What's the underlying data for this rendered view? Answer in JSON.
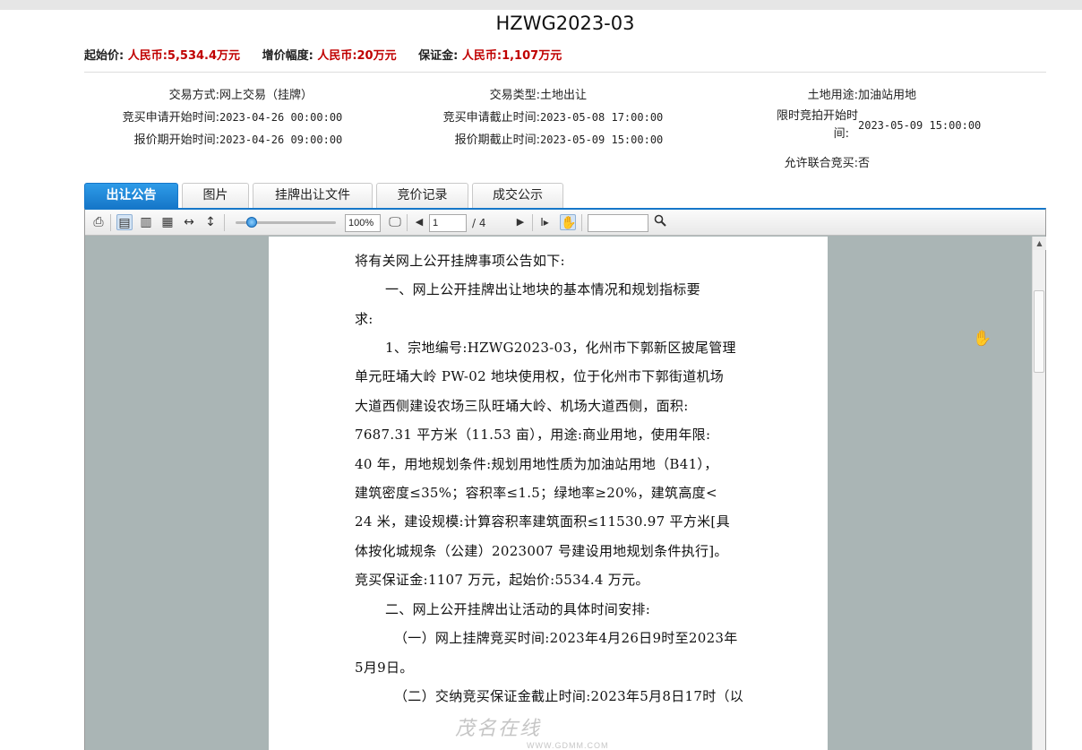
{
  "title": "HZWG2023-03",
  "prices": {
    "start_label": "起始价:",
    "start_value": "人民币:5,534.4万元",
    "increment_label": "增价幅度:",
    "increment_value": "人民币:20万元",
    "deposit_label": "保证金:",
    "deposit_value": "人民币:1,107万元",
    "accent_color": "#c00000"
  },
  "info": {
    "trade_method_label": "交易方式:",
    "trade_method_value": "网上交易（挂牌）",
    "trade_type_label": "交易类型:",
    "trade_type_value": "土地出让",
    "land_use_label": "土地用途:",
    "land_use_value": "加油站用地",
    "apply_start_label": "竞买申请开始时间:",
    "apply_start_value": "2023-04-26 00:00:00",
    "apply_end_label": "竞买申请截止时间:",
    "apply_end_value": "2023-05-08 17:00:00",
    "auction_start_label_1": "限时竞拍开始时",
    "auction_start_label_2": "间:",
    "auction_start_value": "2023-05-09 15:00:00",
    "quote_start_label": "报价期开始时间:",
    "quote_start_value": "2023-04-26 09:00:00",
    "quote_end_label": "报价期截止时间:",
    "quote_end_value": "2023-05-09 15:00:00",
    "joint_label": "允许联合竞买:",
    "joint_value": "否"
  },
  "tabs": [
    {
      "label": "出让公告",
      "active": true
    },
    {
      "label": "图片"
    },
    {
      "label": "挂牌出让文件"
    },
    {
      "label": "竞价记录"
    },
    {
      "label": "成交公示"
    }
  ],
  "toolbar": {
    "zoom": "100%",
    "page_current": "1",
    "page_total": "/ 4",
    "search_value": "",
    "icons": [
      "print-icon",
      "single-page-icon",
      "two-page-icon",
      "grid-view-icon",
      "fit-width-icon",
      "fit-height-icon",
      "fullscreen-icon",
      "prev-page-icon",
      "next-page-icon",
      "text-select-icon",
      "hand-tool-icon",
      "search-icon"
    ]
  },
  "document": {
    "lines": [
      "将有关网上公开挂牌事项公告如下:",
      "一、网上公开挂牌出让地块的基本情况和规划指标要",
      "求:",
      "1、宗地编号:HZWG2023-03，化州市下郭新区披尾管理",
      "单元旺埇大岭 PW-02 地块使用权，位于化州市下郭街道机场",
      "大道西侧建设农场三队旺埇大岭、机场大道西侧，面积:",
      "7687.31 平方米（11.53 亩），用途:商业用地，使用年限:",
      "40 年，用地规划条件:规划用地性质为加油站用地（B41），",
      "建筑密度≤35%；容积率≤1.5；绿地率≥20%，建筑高度<",
      "24 米，建设规模:计算容积率建筑面积≤11530.97 平方米[具",
      "体按化城规条（公建）2023007 号建设用地规划条件执行]。",
      "竞买保证金:1107 万元，起始价:5534.4 万元。",
      "二、网上公开挂牌出让活动的具体时间安排:",
      "（一）网上挂牌竞买时间:2023年4月26日9时至2023年",
      "5月9日。",
      "（二）交纳竞买保证金截止时间:2023年5月8日17时（以"
    ]
  },
  "watermark": {
    "brand": "茂名在线",
    "url": "WWW.GDMM.COM"
  }
}
